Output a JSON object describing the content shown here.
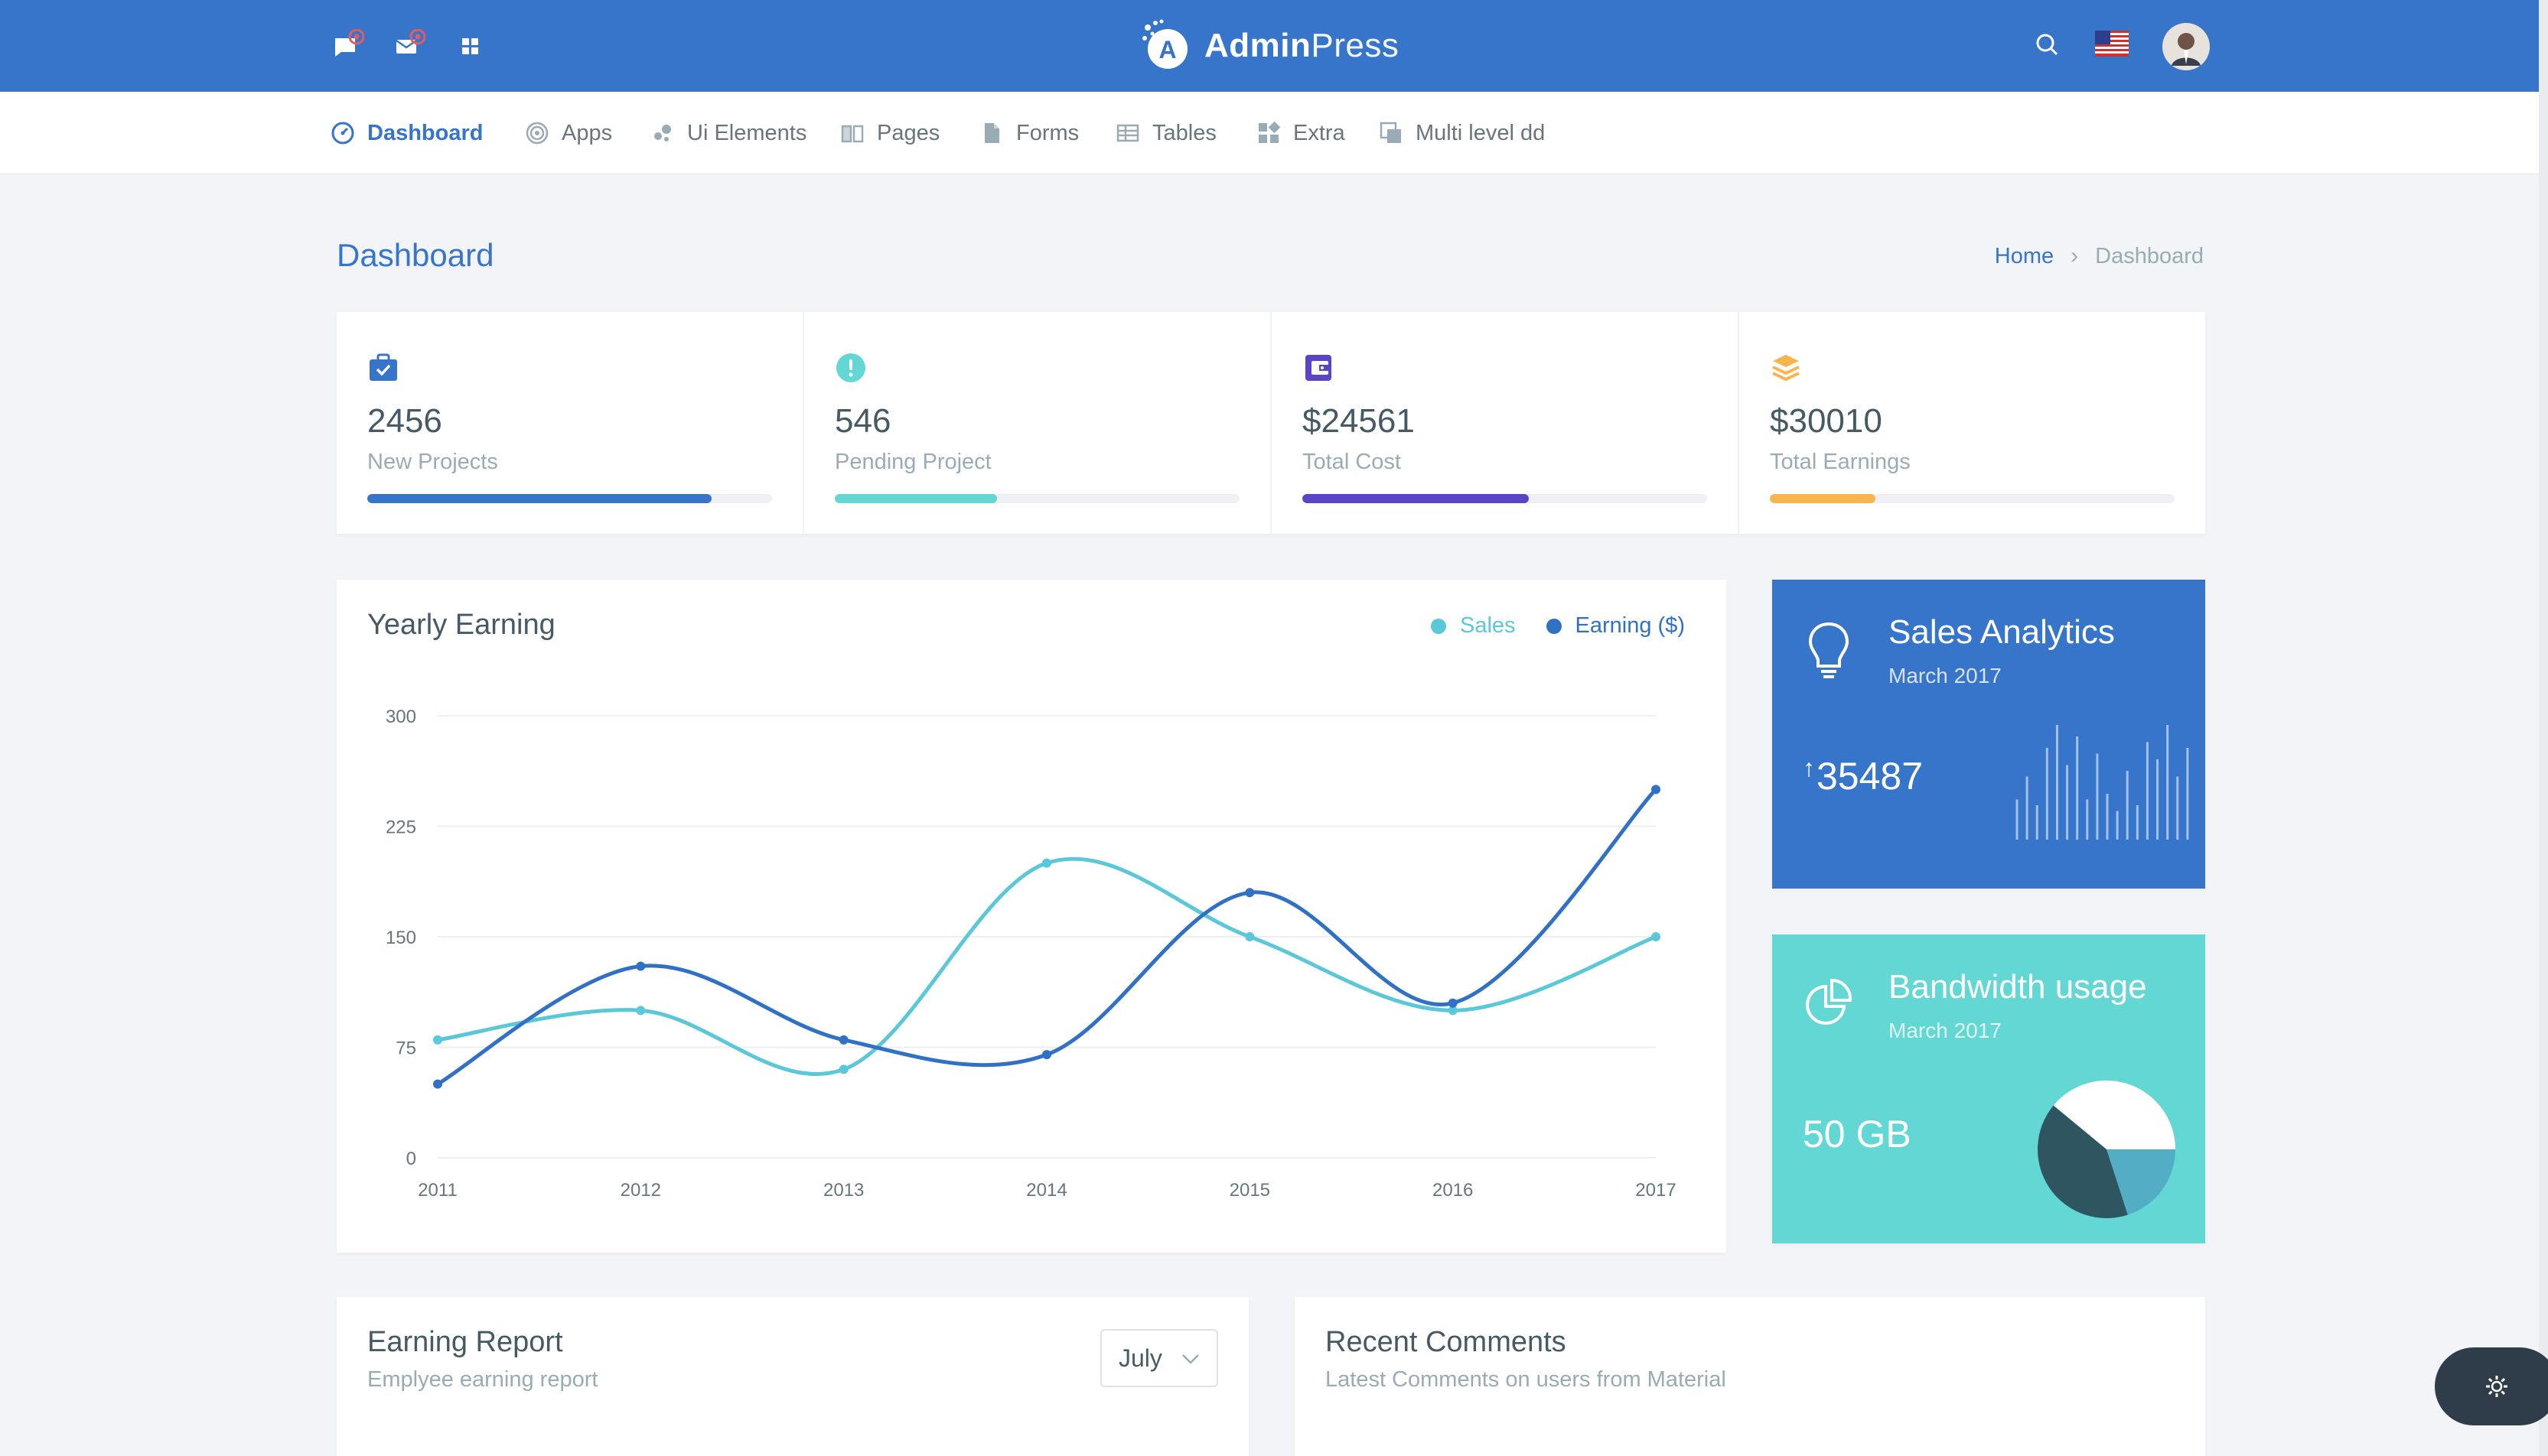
{
  "header": {
    "brand_bold": "Admin",
    "brand_light": "Press",
    "icons": [
      "message-icon",
      "mail-icon",
      "grid-icon",
      "search-icon",
      "us-flag-icon",
      "avatar"
    ]
  },
  "nav": {
    "items": [
      {
        "label": "Dashboard",
        "icon": "gauge-icon",
        "active": true
      },
      {
        "label": "Apps",
        "icon": "target-icon"
      },
      {
        "label": "Ui Elements",
        "icon": "bubbles-icon"
      },
      {
        "label": "Pages",
        "icon": "book-icon"
      },
      {
        "label": "Forms",
        "icon": "file-icon"
      },
      {
        "label": "Tables",
        "icon": "table-icon"
      },
      {
        "label": "Extra",
        "icon": "widgets-icon"
      },
      {
        "label": "Multi level dd",
        "icon": "layers-icon"
      }
    ]
  },
  "page": {
    "title": "Dashboard",
    "breadcrumb": {
      "home": "Home",
      "sep": "›",
      "current": "Dashboard"
    }
  },
  "stats": [
    {
      "value": "2456",
      "label": "New Projects",
      "progress": 0.85,
      "color": "#3775cb",
      "icon": "briefcase-icon"
    },
    {
      "value": "546",
      "label": "Pending Project",
      "progress": 0.4,
      "color": "#63d7d3",
      "icon": "alert-icon"
    },
    {
      "value": "$24561",
      "label": "Total Cost",
      "progress": 0.56,
      "color": "#5b45c5",
      "icon": "wallet-icon"
    },
    {
      "value": "$30010",
      "label": "Total Earnings",
      "progress": 0.26,
      "color": "#f9b54d",
      "icon": "stack-icon"
    }
  ],
  "yearly": {
    "title": "Yearly Earning",
    "legend": [
      {
        "name": "Sales",
        "color": "#5ac8d8"
      },
      {
        "name": "Earning ($)",
        "color": "#3071c6"
      }
    ]
  },
  "chart_data": {
    "type": "line",
    "title": "Yearly Earning",
    "x": [
      "2011",
      "2012",
      "2013",
      "2014",
      "2015",
      "2016",
      "2017"
    ],
    "yticks": [
      "300",
      "225",
      "150",
      "75",
      "0"
    ],
    "ylim": [
      0,
      300
    ],
    "grid": true,
    "legend": "top-right",
    "series": [
      {
        "name": "Sales",
        "color": "#5ac8d8",
        "values": [
          80,
          100,
          60,
          200,
          150,
          100,
          150
        ]
      },
      {
        "name": "Earning ($)",
        "color": "#3071c6",
        "values": [
          50,
          130,
          80,
          70,
          180,
          105,
          250
        ]
      }
    ]
  },
  "sales_analytics": {
    "title": "Sales Analytics",
    "subtitle": "March 2017",
    "arrow": "↑",
    "value": "35487",
    "sparkline": [
      0.35,
      0.55,
      0.3,
      0.8,
      1.0,
      0.65,
      0.9,
      0.35,
      0.75,
      0.4,
      0.25,
      0.6,
      0.3,
      0.85,
      0.7,
      1.0,
      0.55,
      0.8
    ]
  },
  "bandwidth": {
    "title": "Bandwidth usage",
    "subtitle": "March 2017",
    "value": "50 GB",
    "pie": [
      {
        "share": 0.39,
        "color": "#ffffff"
      },
      {
        "share": 0.2,
        "color": "#53adc4"
      },
      {
        "share": 0.41,
        "color": "#2f5561"
      }
    ]
  },
  "earning_report": {
    "title": "Earning Report",
    "subtitle": "Emplyee earning report",
    "month": "July"
  },
  "recent_comments": {
    "title": "Recent Comments",
    "subtitle": "Latest Comments on users from Material"
  }
}
